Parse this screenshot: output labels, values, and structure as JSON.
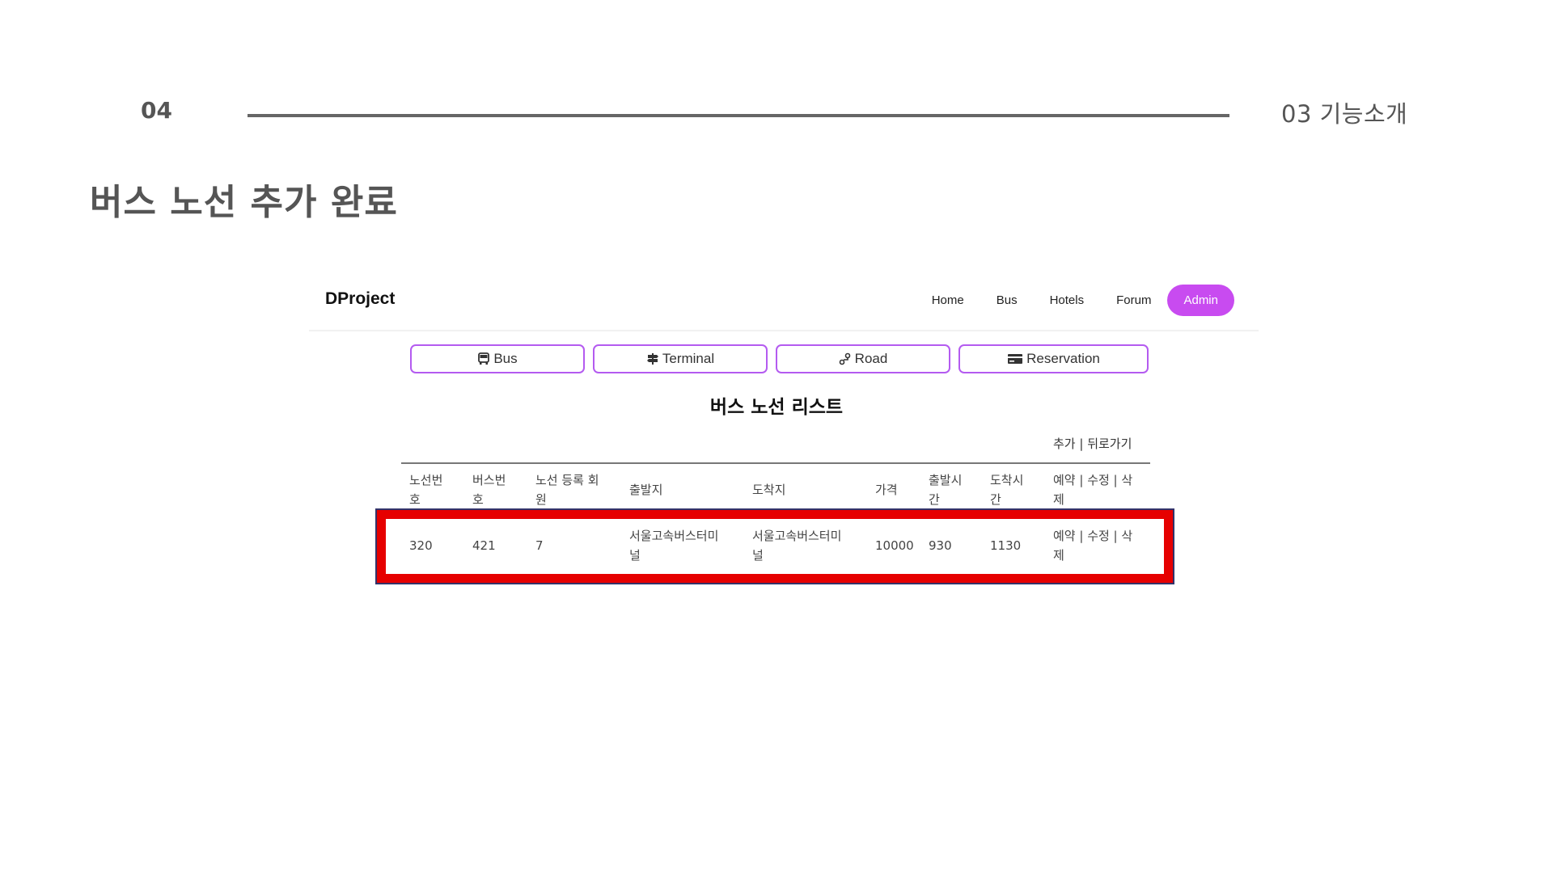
{
  "slide": {
    "page_number": "04",
    "section_title": "03 기능소개",
    "heading": "버스 노선 추가 완료"
  },
  "navbar": {
    "brand": "DProject",
    "links": [
      {
        "label": "Home"
      },
      {
        "label": "Bus"
      },
      {
        "label": "Hotels"
      },
      {
        "label": "Forum"
      },
      {
        "label": "Admin"
      }
    ],
    "accent_color": "#c84bf0"
  },
  "tabs": [
    {
      "label": "Bus",
      "icon": "bus-icon"
    },
    {
      "label": "Terminal",
      "icon": "signpost-icon"
    },
    {
      "label": "Road",
      "icon": "route-icon"
    },
    {
      "label": "Reservation",
      "icon": "card-icon"
    }
  ],
  "list_title": "버스 노선 리스트",
  "table_actions": {
    "add": "추가",
    "separator": " | ",
    "back": "뒤로가기"
  },
  "table": {
    "headers": [
      "노선번\n호",
      "버스번\n호",
      "노선 등록 회\n원",
      "출발지",
      "도착지",
      "가격",
      "출발시\n간",
      "도착시\n간",
      "예약 | 수정 | 삭\n제"
    ],
    "rows": [
      [
        "320",
        "421",
        "7",
        "서울고속버스터미\n널",
        "서울고속버스터미\n널",
        "10000",
        "930",
        "1130",
        "예약 | 수정 | 삭\n제"
      ]
    ]
  },
  "highlight_color": "#e60000"
}
